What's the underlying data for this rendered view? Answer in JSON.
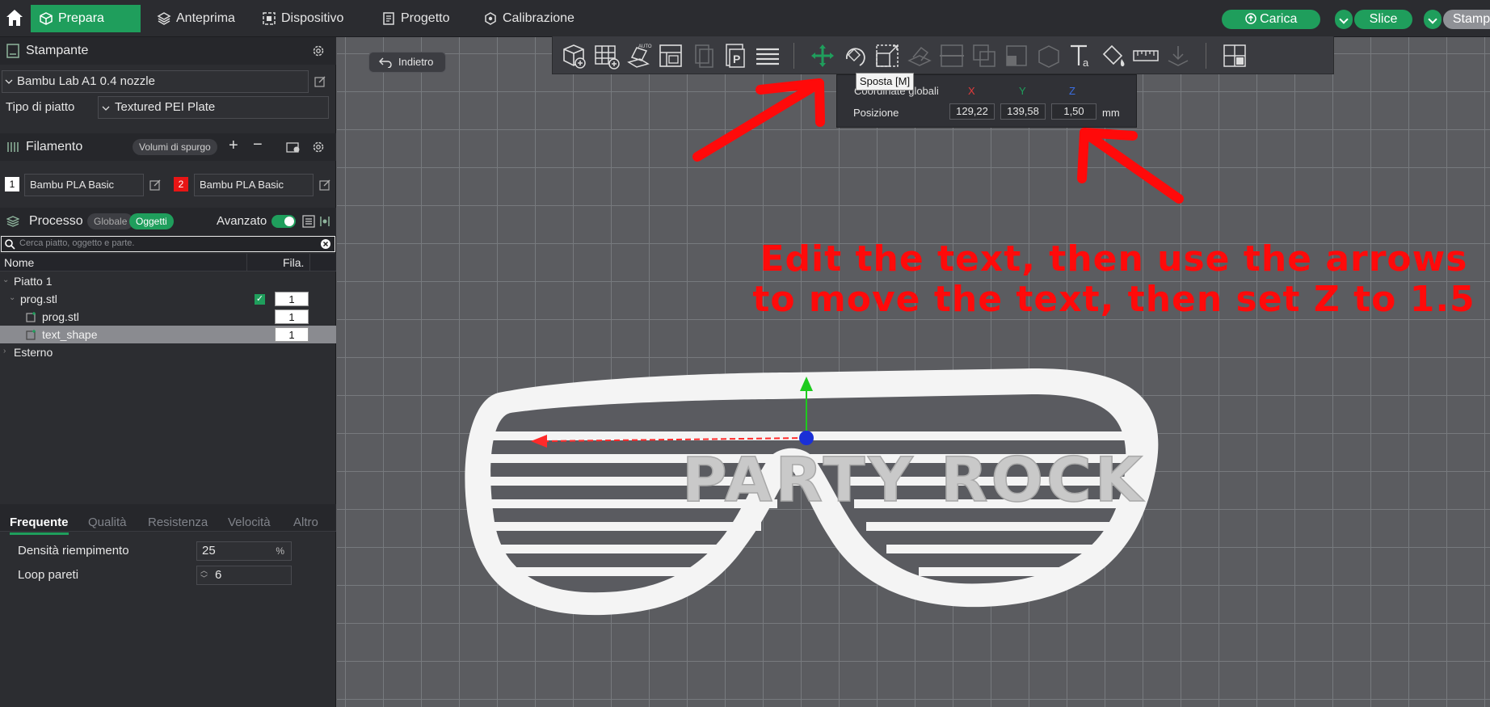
{
  "topbar": {
    "tabs": [
      {
        "label": "Prepara",
        "active": true
      },
      {
        "label": "Anteprima"
      },
      {
        "label": "Dispositivo"
      },
      {
        "label": "Progetto"
      },
      {
        "label": "Calibrazione"
      }
    ],
    "upload_label": "Carica",
    "slice_label": "Slice",
    "print_label": "Stamp"
  },
  "printer": {
    "section_title": "Stampante",
    "name": "Bambu Lab A1 0.4 nozzle",
    "plate_type_label": "Tipo di piatto",
    "plate_type_value": "Textured PEI Plate"
  },
  "filament": {
    "section_title": "Filamento",
    "flush_label": "Volumi di spurgo",
    "slots": [
      {
        "index": "1",
        "name": "Bambu PLA Basic",
        "color": "#ffffff"
      },
      {
        "index": "2",
        "name": "Bambu PLA Basic",
        "color": "#e81515"
      }
    ]
  },
  "process": {
    "section_title": "Processo",
    "scope_global": "Globale",
    "scope_objects": "Oggetti",
    "advanced_label": "Avanzato",
    "search_placeholder": "Cerca piatto, oggetto e parte.",
    "columns": {
      "name": "Nome",
      "fila": "Fila."
    },
    "tree": [
      {
        "label": "Piatto 1"
      },
      {
        "label": "prog.stl",
        "fila": "1"
      },
      {
        "label": "prog.stl",
        "fila": "1"
      },
      {
        "label": "text_shape",
        "fila": "1"
      },
      {
        "label": "Esterno"
      }
    ],
    "tabs": [
      "Frequente",
      "Qualità",
      "Resistenza",
      "Velocità",
      "Altro"
    ],
    "settings": {
      "infill_label": "Densità riempimento",
      "infill_value": "25",
      "infill_unit": "%",
      "walls_label": "Loop pareti",
      "walls_value": "6"
    }
  },
  "viewport": {
    "back_label": "Indietro",
    "tooltip": "Sposta [M]",
    "move_panel": {
      "coords_label": "Coordinate globali",
      "x_label": "X",
      "y_label": "Y",
      "z_label": "Z",
      "position_label": "Posizione",
      "x": "129,22",
      "y": "139,58",
      "z": "1,50",
      "unit": "mm"
    },
    "instruction_line1": "Edit the text, then use the arrows",
    "instruction_line2": "to move the text, then set Z to 1.5",
    "model_text": "PARTY ROCK"
  },
  "colors": {
    "accent": "#1f9e5c",
    "annotation": "#ff0a0a"
  }
}
